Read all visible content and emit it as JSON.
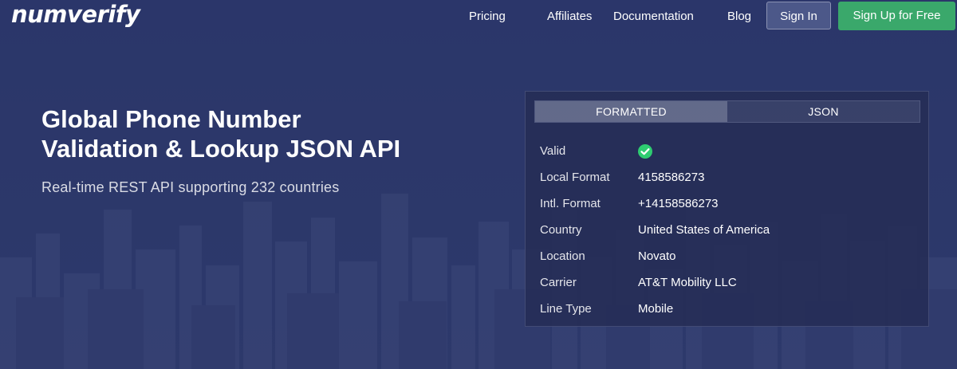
{
  "brand": {
    "logo_text": "numverify"
  },
  "nav": {
    "links": [
      {
        "label": "Pricing"
      },
      {
        "label": "Affiliates"
      },
      {
        "label": "Documentation"
      },
      {
        "label": "Blog"
      }
    ],
    "signin_label": "Sign In",
    "signup_label": "Sign Up for Free"
  },
  "hero": {
    "title_line1": "Global Phone Number",
    "title_line2": "Validation & Lookup JSON API",
    "subtitle": "Real-time REST API supporting 232 countries"
  },
  "result_panel": {
    "tabs": [
      {
        "label": "FORMATTED",
        "active": true
      },
      {
        "label": "JSON",
        "active": false
      }
    ],
    "rows": [
      {
        "label": "Valid",
        "value": "",
        "icon": "check-circle-icon"
      },
      {
        "label": "Local Format",
        "value": "4158586273"
      },
      {
        "label": "Intl. Format",
        "value": "+14158586273"
      },
      {
        "label": "Country",
        "value": "United States of America"
      },
      {
        "label": "Location",
        "value": "Novato"
      },
      {
        "label": "Carrier",
        "value": "AT&T Mobility LLC"
      },
      {
        "label": "Line Type",
        "value": "Mobile"
      }
    ]
  },
  "colors": {
    "background": "#2f3b6a",
    "signup_button": "#3aa86b",
    "valid_check": "#2ecc71"
  }
}
